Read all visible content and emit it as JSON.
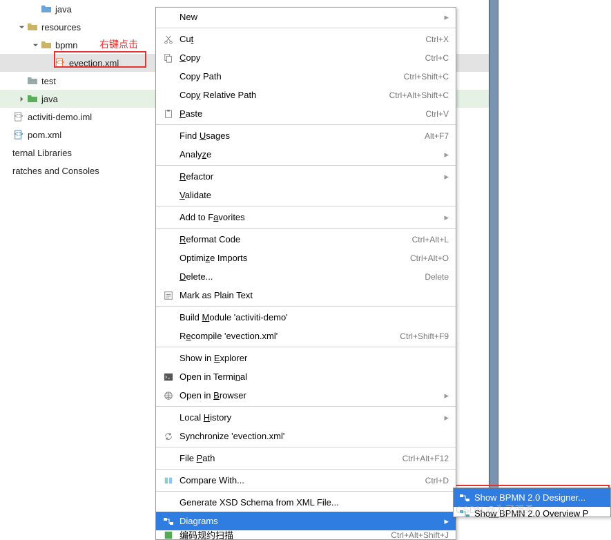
{
  "annotations": {
    "right_click_label": "右键点击",
    "watermark": "CSDN @为了温柔"
  },
  "tree": [
    {
      "indent": 2,
      "arrow": "",
      "icon": "folder-blue",
      "label": "java"
    },
    {
      "indent": 1,
      "arrow": "down",
      "icon": "folder-yellow",
      "label": "resources"
    },
    {
      "indent": 2,
      "arrow": "down",
      "icon": "folder-yellow",
      "label": "bpmn"
    },
    {
      "indent": 3,
      "arrow": "",
      "icon": "file-xml",
      "label": "evection.xml",
      "wide": true
    },
    {
      "indent": 1,
      "arrow": "",
      "icon": "folder-grey",
      "label": "test"
    },
    {
      "indent": 1,
      "arrow": "right",
      "icon": "folder-green",
      "label": "java",
      "green": true
    },
    {
      "indent": 0,
      "arrow": "",
      "icon": "file-iml",
      "label": "activiti-demo.iml"
    },
    {
      "indent": 0,
      "arrow": "",
      "icon": "file-pom",
      "label": "pom.xml"
    },
    {
      "indent": -1,
      "arrow": "",
      "icon": "",
      "label": "ternal Libraries"
    },
    {
      "indent": -1,
      "arrow": "",
      "icon": "",
      "label": "ratches and Consoles"
    }
  ],
  "menu": [
    {
      "type": "item",
      "icon": "",
      "label": "New",
      "sub": true
    },
    {
      "type": "sep"
    },
    {
      "type": "item",
      "icon": "cut",
      "label": "Cu<u>t</u>",
      "shortcut": "Ctrl+X"
    },
    {
      "type": "item",
      "icon": "copy",
      "label": "<u>C</u>opy",
      "shortcut": "Ctrl+C"
    },
    {
      "type": "item",
      "icon": "",
      "label": "Copy Path",
      "shortcut": "Ctrl+Shift+C"
    },
    {
      "type": "item",
      "icon": "",
      "label": "Cop<u>y</u> Relative Path",
      "shortcut": "Ctrl+Alt+Shift+C"
    },
    {
      "type": "item",
      "icon": "paste",
      "label": "<u>P</u>aste",
      "shortcut": "Ctrl+V"
    },
    {
      "type": "sep"
    },
    {
      "type": "item",
      "icon": "",
      "label": "Find <u>U</u>sages",
      "shortcut": "Alt+F7"
    },
    {
      "type": "item",
      "icon": "",
      "label": "Analy<u>z</u>e",
      "sub": true
    },
    {
      "type": "sep"
    },
    {
      "type": "item",
      "icon": "",
      "label": "<u>R</u>efactor",
      "sub": true
    },
    {
      "type": "item",
      "icon": "",
      "label": "<u>V</u>alidate"
    },
    {
      "type": "sep"
    },
    {
      "type": "item",
      "icon": "",
      "label": "Add to F<u>a</u>vorites",
      "sub": true
    },
    {
      "type": "sep"
    },
    {
      "type": "item",
      "icon": "",
      "label": "<u>R</u>eformat Code",
      "shortcut": "Ctrl+Alt+L"
    },
    {
      "type": "item",
      "icon": "",
      "label": "Optimi<u>z</u>e Imports",
      "shortcut": "Ctrl+Alt+O"
    },
    {
      "type": "item",
      "icon": "",
      "label": "<u>D</u>elete...",
      "shortcut": "Delete"
    },
    {
      "type": "item",
      "icon": "mark",
      "label": "Mark as Plain Text"
    },
    {
      "type": "sep"
    },
    {
      "type": "item",
      "icon": "",
      "label": "Build <u>M</u>odule 'activiti-demo'"
    },
    {
      "type": "item",
      "icon": "",
      "label": "R<u>e</u>compile 'evection.xml'",
      "shortcut": "Ctrl+Shift+F9"
    },
    {
      "type": "sep"
    },
    {
      "type": "item",
      "icon": "",
      "label": "Show in <u>E</u>xplorer"
    },
    {
      "type": "item",
      "icon": "terminal",
      "label": "Open in Termi<u>n</u>al"
    },
    {
      "type": "item",
      "icon": "browser",
      "label": "Open in <u>B</u>rowser",
      "sub": true
    },
    {
      "type": "sep"
    },
    {
      "type": "item",
      "icon": "",
      "label": "Local <u>H</u>istory",
      "sub": true
    },
    {
      "type": "item",
      "icon": "sync",
      "label": "Synchronize 'evection.xml'"
    },
    {
      "type": "sep"
    },
    {
      "type": "item",
      "icon": "",
      "label": "File <u>P</u>ath",
      "shortcut": "Ctrl+Alt+F12"
    },
    {
      "type": "sep"
    },
    {
      "type": "item",
      "icon": "compare",
      "label": "Compare With...",
      "shortcut": "Ctrl+D"
    },
    {
      "type": "sep"
    },
    {
      "type": "item",
      "icon": "",
      "label": "Generate XSD Schema from XML File..."
    },
    {
      "type": "item",
      "icon": "diagram",
      "label": "Diagrams",
      "sub": true,
      "hl": true
    },
    {
      "type": "item",
      "icon": "ext",
      "label": "编码规约扫描",
      "shortcut": "Ctrl+Alt+Shift+J",
      "cut": true
    }
  ],
  "submenu": [
    {
      "icon": "diagram",
      "label": "Show BPMN 2.0 Designer...",
      "hl": true
    },
    {
      "icon": "diagram2",
      "label": "Show BPMN 2.0 Overview P"
    }
  ]
}
